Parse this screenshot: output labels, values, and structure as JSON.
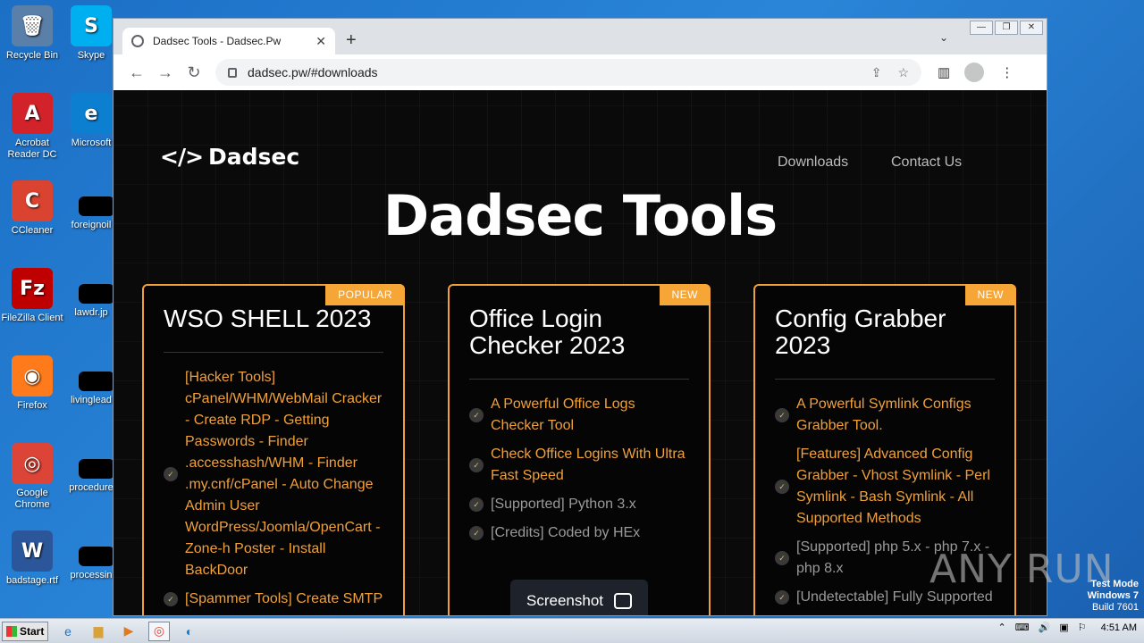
{
  "desktop": {
    "icons": [
      {
        "label": "Recycle Bin",
        "glyph": "🗑",
        "color": "#5a7fa8"
      },
      {
        "label": "Acrobat Reader DC",
        "glyph": "A",
        "color": "#d2232a"
      },
      {
        "label": "CCleaner",
        "glyph": "C",
        "color": "#d9432f"
      },
      {
        "label": "FileZilla Client",
        "glyph": "Fz",
        "color": "#bf0000"
      },
      {
        "label": "Firefox",
        "glyph": "◉",
        "color": "#ff7a1a"
      },
      {
        "label": "Google Chrome",
        "glyph": "◎",
        "color": "#db4437"
      },
      {
        "label": "badstage.rtf",
        "glyph": "W",
        "color": "#2b579a"
      }
    ],
    "icons_col2": [
      {
        "label": "Skype",
        "glyph": "S",
        "color": "#00aff0"
      },
      {
        "label": "Microsoft",
        "glyph": "e",
        "color": "#0c7fd1"
      },
      {
        "label": "foreignoil",
        "glyph": "",
        "color": "#000"
      },
      {
        "label": "lawdr.jp",
        "glyph": "",
        "color": "#000"
      },
      {
        "label": "livinglead",
        "glyph": "",
        "color": "#000"
      },
      {
        "label": "procedure",
        "glyph": "",
        "color": "#000"
      },
      {
        "label": "processin",
        "glyph": "",
        "color": "#000"
      }
    ]
  },
  "browser": {
    "tab_title": "Dadsec Tools - Dadsec.Pw",
    "url": "dadsec.pw/#downloads",
    "new_tab": "+",
    "tab_close": "✕"
  },
  "site": {
    "logo_code": "</>",
    "logo_text": "Dadsec",
    "nav": [
      "Downloads",
      "Contact Us"
    ],
    "hero": "Dadsec Tools",
    "screenshot_button": "Screenshot",
    "cards": [
      {
        "badge": "POPULAR",
        "title": "WSO SHELL 2023",
        "features": [
          {
            "text": "[Hacker Tools] cPanel/WHM/WebMail Cracker - Create RDP - Getting Passwords - Finder .accesshash/WHM - Finder .my.cnf/cPanel - Auto Change Admin User WordPress/Joomla/OpenCart - Zone-h Poster - Install BackDoor",
            "style": "orange"
          },
          {
            "text": "[Spammer Tools] Create SMTP",
            "style": "orange"
          }
        ]
      },
      {
        "badge": "NEW",
        "title": "Office Login Checker 2023",
        "features": [
          {
            "text": "A Powerful Office Logs Checker Tool",
            "style": "orange"
          },
          {
            "text": "Check Office Logins With Ultra Fast Speed",
            "style": "orange"
          },
          {
            "text": "[Supported] Python 3.x",
            "style": "gray"
          },
          {
            "text": "[Credits] Coded by HEx",
            "style": "gray"
          }
        ]
      },
      {
        "badge": "NEW",
        "title": "Config Grabber 2023",
        "features": [
          {
            "text": "A Powerful Symlink Configs Grabber Tool.",
            "style": "orange"
          },
          {
            "text": "[Features] Advanced Config Grabber - Vhost Symlink - Perl Symlink - Bash Symlink - All Supported Methods",
            "style": "orange"
          },
          {
            "text": "[Supported] php 5.x - php 7.x - php 8.x",
            "style": "gray"
          },
          {
            "text": "[Undetectable] Fully Supported",
            "style": "gray"
          }
        ]
      }
    ]
  },
  "watermark": "ANY RUN",
  "testmode": [
    "Test Mode",
    "Windows 7",
    "Build 7601"
  ],
  "taskbar": {
    "start": "Start",
    "clock": "4:51 AM"
  },
  "colors": {
    "accent": "#f0a13a",
    "page_bg": "#0a0a0a"
  }
}
